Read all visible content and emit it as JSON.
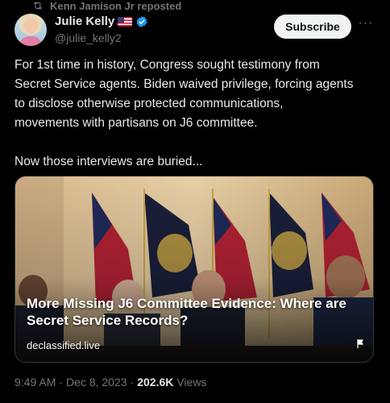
{
  "repost": {
    "label": "Kenn Jamison Jr reposted"
  },
  "author": {
    "name": "Julie Kelly",
    "handle": "@julie_kelly2"
  },
  "subscribe_label": "Subscribe",
  "more_label": "···",
  "tweet": {
    "text": "For 1st time in history, Congress sought testimony from\nSecret Service agents. Biden waived privilege, forcing agents\nto disclose otherwise protected communications,\nmovements with partisans on J6 committee.\n\nNow those interviews are buried..."
  },
  "card": {
    "headline": "More Missing J6 Committee Evidence: Where are Secret Service Records?",
    "domain": "declassified.live"
  },
  "meta": {
    "time": "9:49 AM",
    "sep1": "·",
    "date": "Dec 8, 2023",
    "sep2": "·",
    "views_count": "202.6K",
    "views_label": "Views"
  },
  "colors": {
    "background": "#000000",
    "muted": "#71767b",
    "verified": "#1d9bf0"
  },
  "icons": [
    "repost-icon",
    "verified-badge-icon",
    "flag-emoji-icon",
    "more-icon",
    "card-flag-icon"
  ]
}
